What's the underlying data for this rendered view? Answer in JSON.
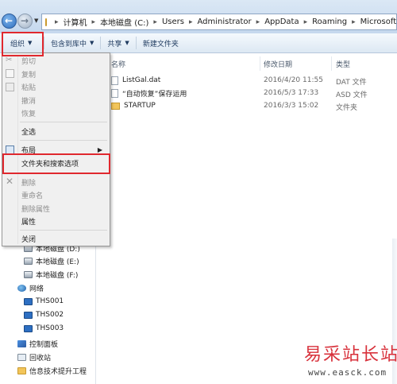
{
  "address_bar": {
    "crumbs": [
      "计算机",
      "本地磁盘 (C:)",
      "Users",
      "Administrator",
      "AppData",
      "Roaming",
      "Microsoft"
    ]
  },
  "toolbar": {
    "organize": "组织",
    "include_library": "包含到库中",
    "share": "共享",
    "new_folder": "新建文件夹"
  },
  "menu": {
    "cut": "剪切",
    "copy": "复制",
    "paste": "粘贴",
    "undo": "撤消",
    "redo": "恢复",
    "select_all": "全选",
    "layout": "布局",
    "folder_options": "文件夹和搜索选项",
    "delete": "删除",
    "rename": "重命名",
    "remove_properties": "删除属性",
    "properties": "属性",
    "close": "关闭"
  },
  "nav": {
    "drive_d": "本地磁盘 (D:)",
    "drive_e": "本地磁盘 (E:)",
    "drive_f": "本地磁盘 (F:)",
    "network": "网络",
    "pc1": "THS001",
    "pc2": "THS002",
    "pc3": "THS003",
    "control_panel": "控制面板",
    "recycle_bin": "回收站",
    "folder": "信息技术提升工程"
  },
  "columns": {
    "name": "名称",
    "modified": "修改日期",
    "type": "类型"
  },
  "files": [
    {
      "name": "ListGal.dat",
      "modified": "2016/4/20 11:55",
      "type": "DAT 文件"
    },
    {
      "name": "“自动恢复”保存运用",
      "modified": "2016/5/3 17:33",
      "type": "ASD 文件"
    },
    {
      "name": "STARTUP",
      "modified": "2016/3/3 15:02",
      "type": "文件夹"
    }
  ],
  "watermark": {
    "title": "易采站长站",
    "url": "www.easck.com"
  }
}
